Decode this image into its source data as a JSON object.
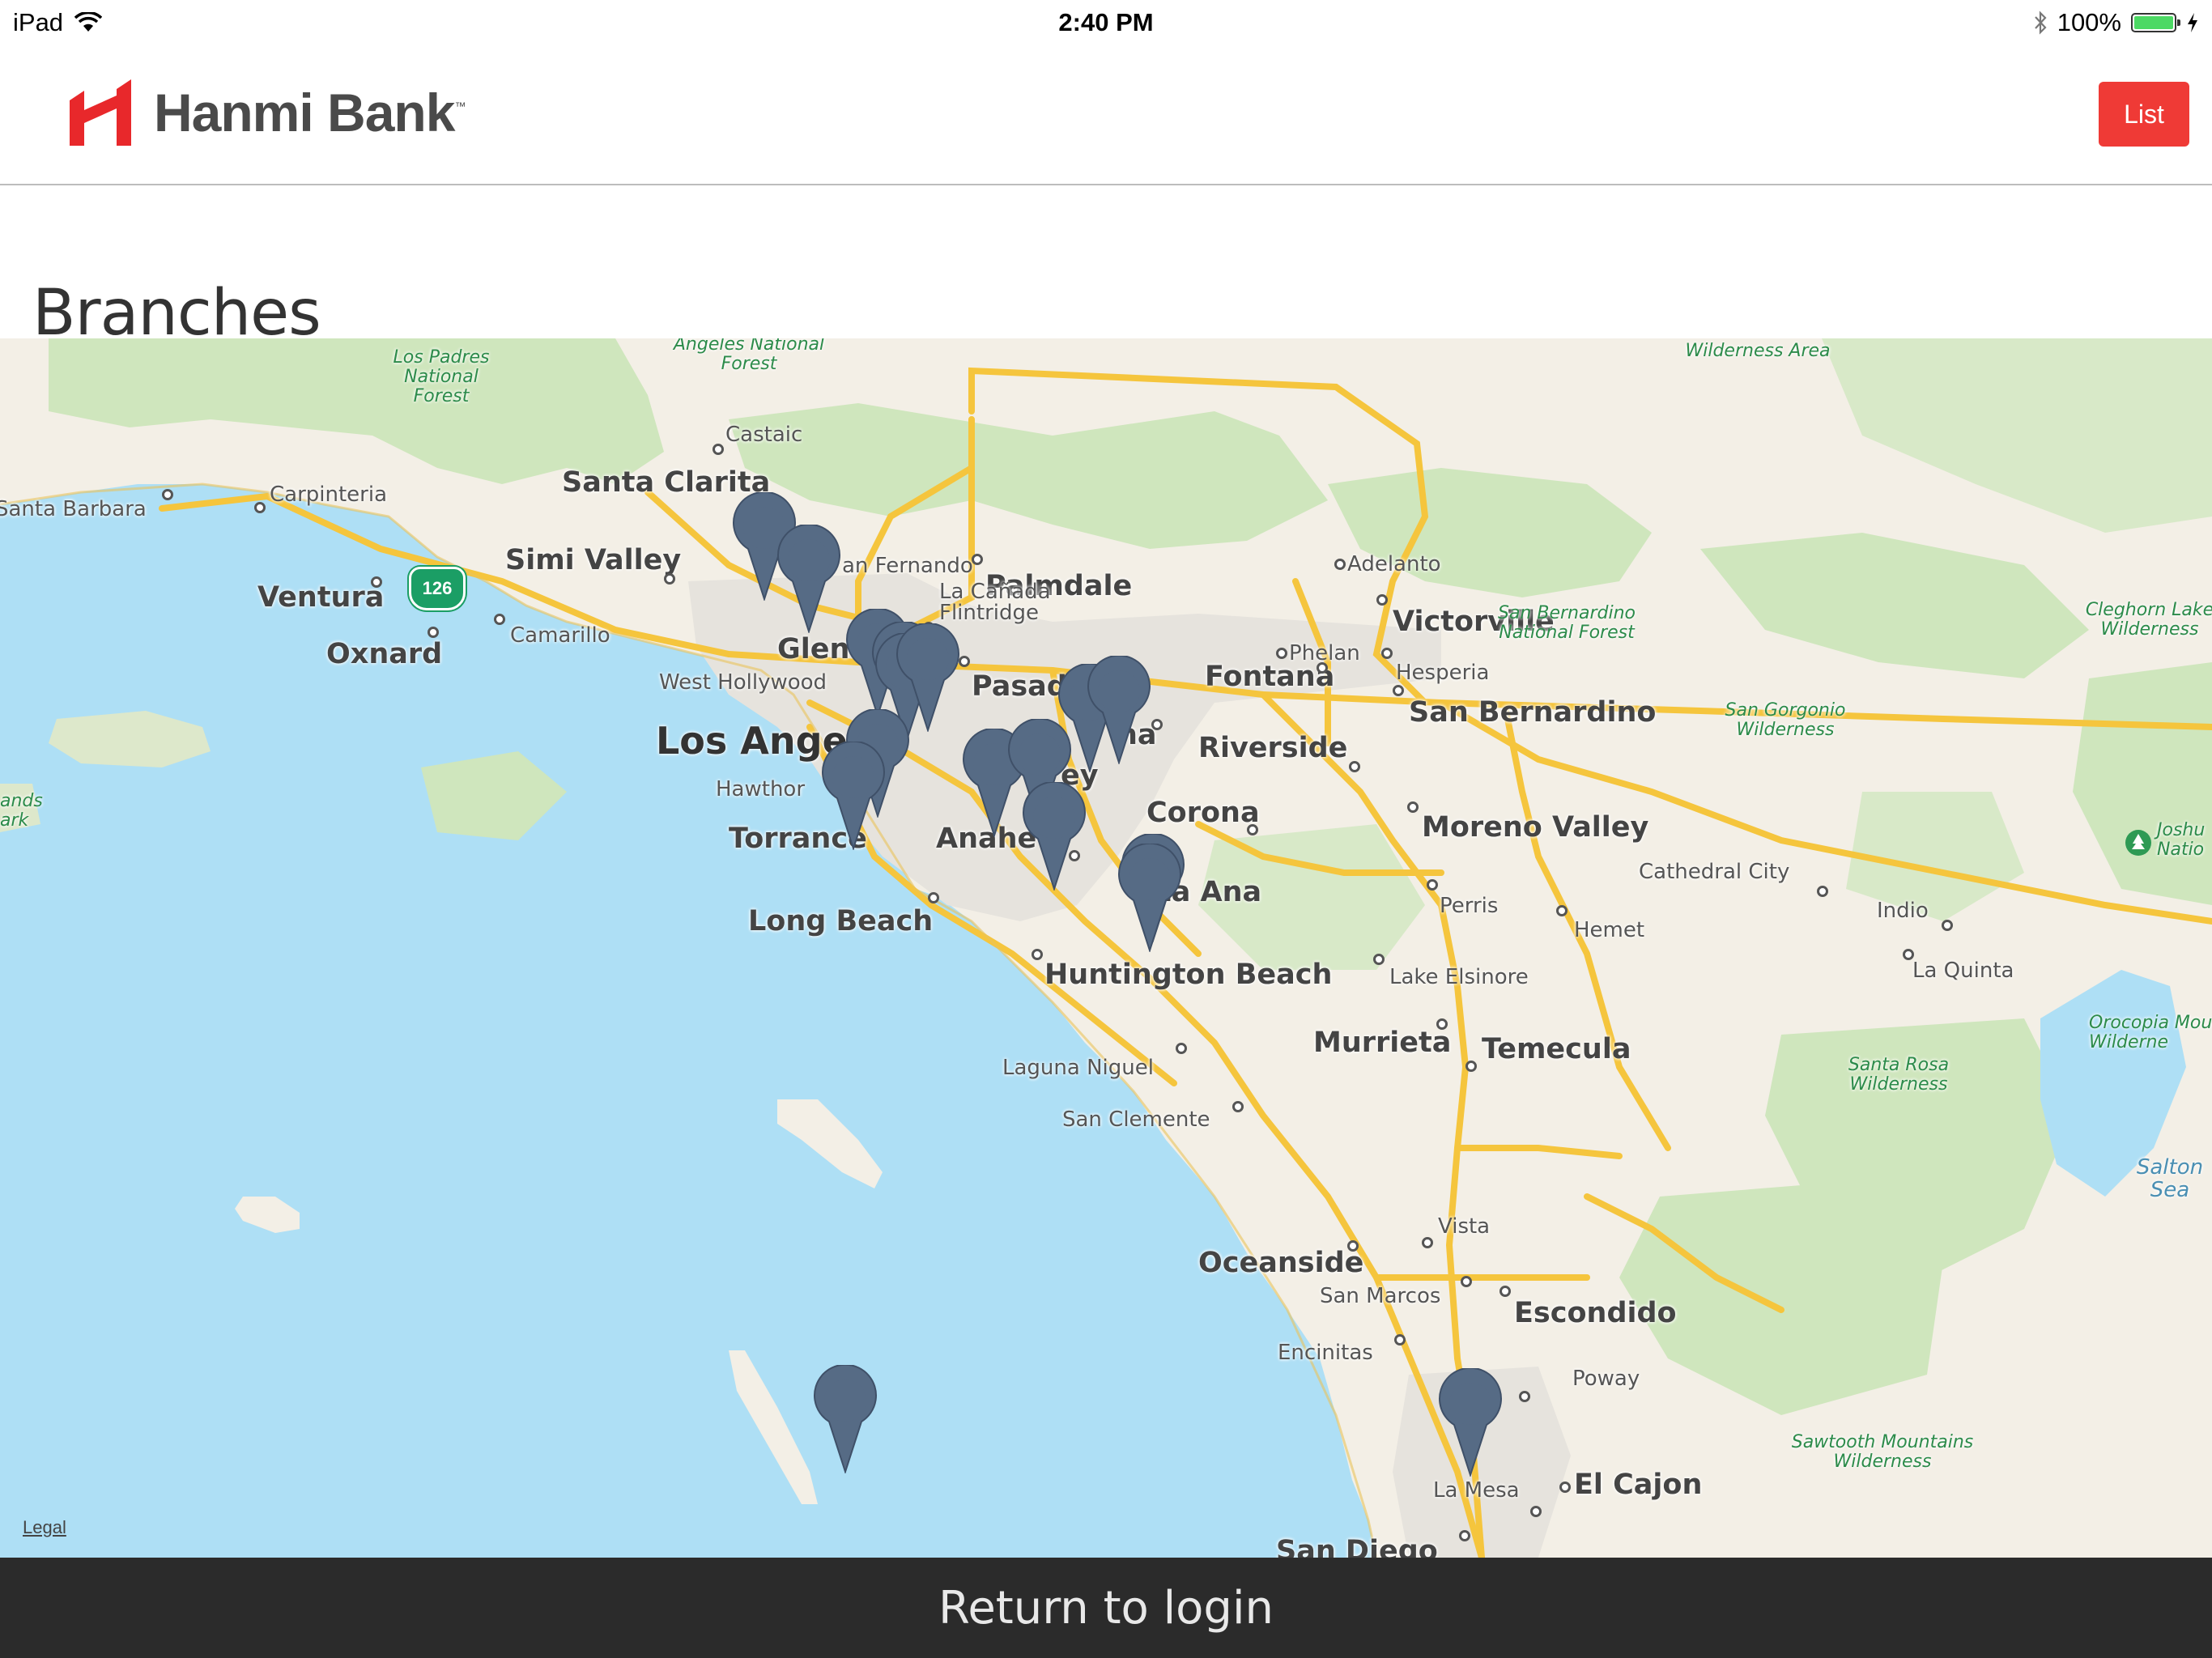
{
  "status_bar": {
    "device": "iPad",
    "time": "2:40 PM",
    "battery_text": "100%"
  },
  "header": {
    "brand_name": "Hanmi Bank",
    "trademark": "™",
    "list_button": "List",
    "brand_color": "#ef3a36"
  },
  "page": {
    "title": "Branches"
  },
  "map": {
    "legal": "Legal",
    "highway_shield": "126",
    "places": [
      {
        "id": "palmdale",
        "label": "Palmdale"
      },
      {
        "id": "adelanto",
        "label": "Adelanto"
      },
      {
        "id": "victorville",
        "label": "Victorville"
      },
      {
        "id": "phelan",
        "label": "Phelan"
      },
      {
        "id": "hesperia",
        "label": "Hesperia"
      },
      {
        "id": "castaic",
        "label": "Castaic"
      },
      {
        "id": "santa_clarita",
        "label": "Santa Clarita"
      },
      {
        "id": "carpinteria",
        "label": "Carpinteria"
      },
      {
        "id": "santa_barbara",
        "label": "Santa Barbara"
      },
      {
        "id": "simi_valley",
        "label": "Simi Valley"
      },
      {
        "id": "ventura",
        "label": "Ventura"
      },
      {
        "id": "san_fernando",
        "label": "an Fernando"
      },
      {
        "id": "la_canada",
        "label": "La Cañada"
      },
      {
        "id": "flintridge",
        "label": "Flintridge"
      },
      {
        "id": "camarillo",
        "label": "Camarillo"
      },
      {
        "id": "oxnard",
        "label": "Oxnard"
      },
      {
        "id": "glendale",
        "label": "Glen"
      },
      {
        "id": "pasadena",
        "label": "Pasad"
      },
      {
        "id": "west_hollywood",
        "label": "West Hollywood"
      },
      {
        "id": "fontana",
        "label": "Fontana"
      },
      {
        "id": "san_bernardino",
        "label": "San Bernardino"
      },
      {
        "id": "los_angeles",
        "label": "Los Ange"
      },
      {
        "id": "pomona",
        "label": "na"
      },
      {
        "id": "riverside",
        "label": "Riverside"
      },
      {
        "id": "hawthorne",
        "label": "Hawthor"
      },
      {
        "id": "valley",
        "label": "ey"
      },
      {
        "id": "corona",
        "label": "Corona"
      },
      {
        "id": "moreno_valley",
        "label": "Moreno Valley"
      },
      {
        "id": "torrance",
        "label": "Torrance"
      },
      {
        "id": "anaheim",
        "label": "Anahe"
      },
      {
        "id": "santa_ana",
        "label": "ta Ana"
      },
      {
        "id": "cathedral_city",
        "label": "Cathedral City"
      },
      {
        "id": "perris",
        "label": "Perris"
      },
      {
        "id": "hemet",
        "label": "Hemet"
      },
      {
        "id": "indio",
        "label": "Indio"
      },
      {
        "id": "long_beach",
        "label": "Long Beach"
      },
      {
        "id": "la_quinta",
        "label": "La Quinta"
      },
      {
        "id": "huntington_beach",
        "label": "Huntington Beach"
      },
      {
        "id": "lake_elsinore",
        "label": "Lake Elsinore"
      },
      {
        "id": "murrieta",
        "label": "Murrieta"
      },
      {
        "id": "temecula",
        "label": "Temecula"
      },
      {
        "id": "laguna_niguel",
        "label": "Laguna Niguel"
      },
      {
        "id": "san_clemente",
        "label": "San Clemente"
      },
      {
        "id": "vista",
        "label": "Vista"
      },
      {
        "id": "oceanside",
        "label": "Oceanside"
      },
      {
        "id": "san_marcos",
        "label": "San Marcos"
      },
      {
        "id": "escondido",
        "label": "Escondido"
      },
      {
        "id": "encinitas",
        "label": "Encinitas"
      },
      {
        "id": "poway",
        "label": "Poway"
      },
      {
        "id": "la_mesa",
        "label": "La Mesa"
      },
      {
        "id": "el_cajon",
        "label": "El Cajon"
      },
      {
        "id": "san_diego",
        "label": "San Diego"
      }
    ],
    "parks": [
      {
        "id": "los_padres",
        "label": "Los Padres National Forest"
      },
      {
        "id": "angeles",
        "label": "Angeles National Forest"
      },
      {
        "id": "wilderness_area",
        "label": "Wilderness Area"
      },
      {
        "id": "sb_forest",
        "label": "San Bernardino National Forest"
      },
      {
        "id": "cleghorn",
        "label": "Cleghorn Lake Wilderness"
      },
      {
        "id": "san_gorgonio",
        "label": "San Gorgonio Wilderness"
      },
      {
        "id": "joshua",
        "label": "Joshu Natio"
      },
      {
        "id": "santa_rosa",
        "label": "Santa Rosa Wilderness"
      },
      {
        "id": "orocopia",
        "label": "Orocopia Mou Wilderne"
      },
      {
        "id": "sawtooth",
        "label": "Sawtooth Mountains Wilderness"
      },
      {
        "id": "islands",
        "label": "ands ark"
      }
    ],
    "water": [
      {
        "id": "salton",
        "label": "Salton Sea"
      }
    ],
    "branch_pin_count": 17,
    "pin_color": "#566b85"
  },
  "footer": {
    "return_label": "Return to login"
  }
}
